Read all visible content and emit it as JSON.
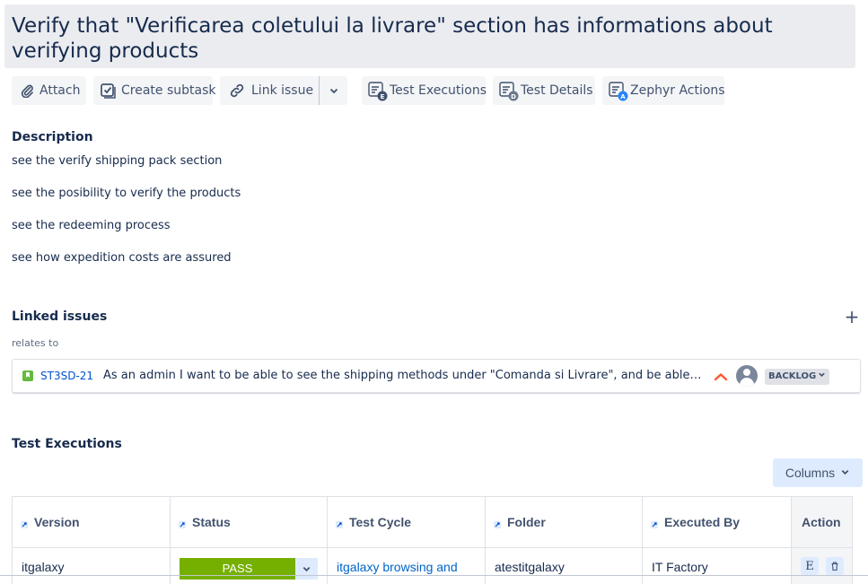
{
  "issue": {
    "title": "Verify that \"Verificarea coletului la livrare\" section has informations about verifying products"
  },
  "toolbar": {
    "attach_label": "Attach",
    "create_subtask_label": "Create subtask",
    "link_issue_label": "Link issue",
    "test_executions_label": "Test Executions",
    "test_details_label": "Test Details",
    "zephyr_actions_label": "Zephyr Actions",
    "badge_letters": {
      "executions": "E",
      "details": "D",
      "zephyr": "A"
    }
  },
  "description": {
    "heading": "Description",
    "lines": [
      "see the verify shipping pack section",
      "see the posibility to verify the products",
      "see the redeeming process",
      "see how expedition costs are assured"
    ]
  },
  "linked_issues": {
    "heading": "Linked issues",
    "relation": "relates to",
    "items": [
      {
        "key": "ST3SD-21",
        "summary": "As an admin I want to be able to see the shipping methods under \"Comanda si Livrare\", and be able to see the different costs",
        "status": "BACKLOG",
        "priority_icon": "priority-high-icon",
        "type_icon": "story-icon"
      }
    ]
  },
  "test_executions": {
    "heading": "Test Executions",
    "columns_button": "Columns",
    "headers": [
      "Version",
      "Status",
      "Test Cycle",
      "Folder",
      "Executed By",
      "Action"
    ],
    "rows": [
      {
        "version": "itgalaxy",
        "status": "PASS",
        "test_cycle": "itgalaxy browsing and",
        "folder": "atestitgalaxy",
        "executed_by": "IT Factory",
        "action_execute": "E"
      }
    ]
  },
  "colors": {
    "accent": "#0052cc",
    "pass": "#75b000",
    "story": "#63ba3c",
    "priority_high": "#ff5630",
    "badge_blue": "#2684ff",
    "badge_gray": "#6b778c"
  }
}
